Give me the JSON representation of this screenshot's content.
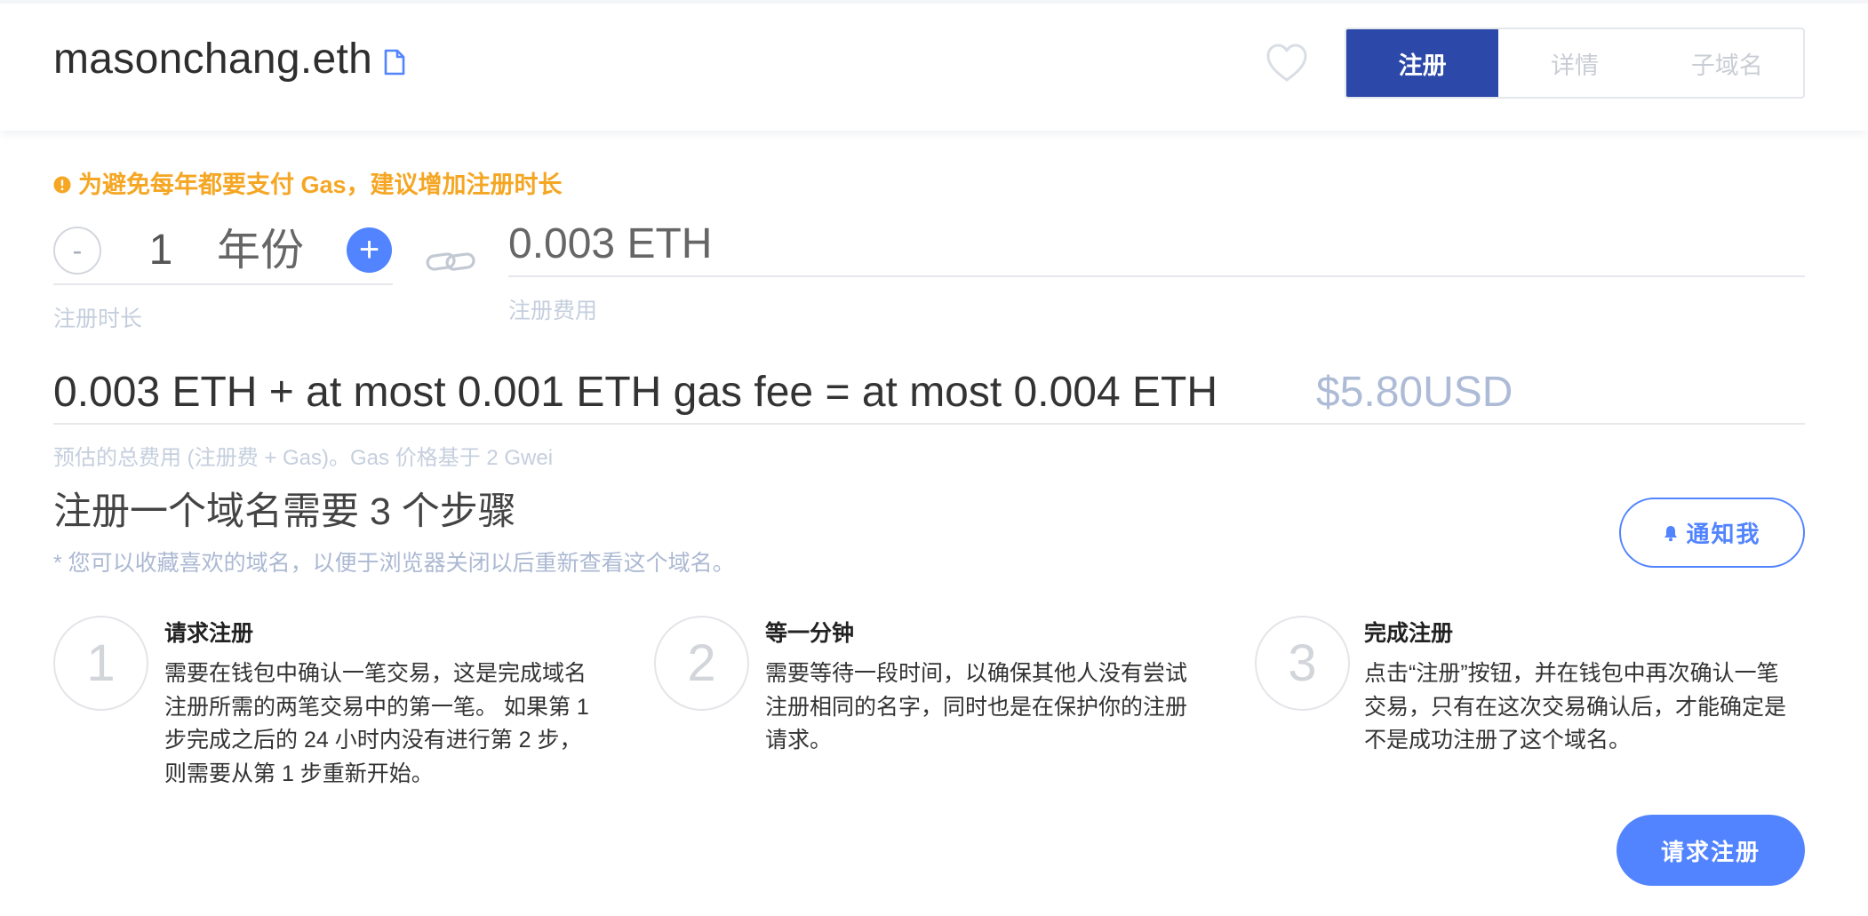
{
  "header": {
    "domain_name": "masonchang.eth",
    "tabs": [
      {
        "label": "注册",
        "active": true
      },
      {
        "label": "详情",
        "active": false
      },
      {
        "label": "子域名",
        "active": false
      }
    ]
  },
  "icons": {
    "domain_document": "file-icon",
    "favorite": "heart-icon",
    "warning": "alert-circle-icon",
    "link": "link-icon",
    "notify": "bell-icon"
  },
  "warning": {
    "text": "为避免每年都要支付 Gas，建议增加注册时长"
  },
  "duration": {
    "decrement_symbol": "-",
    "value": "1",
    "unit": "年份",
    "increment_symbol": "+",
    "label": "注册时长"
  },
  "price": {
    "value": "0.003 ETH",
    "label": "注册费用"
  },
  "total": {
    "summary": "0.003 ETH + at most 0.001 ETH gas fee = at most 0.004 ETH",
    "usd": "$5.80USD",
    "note": "预估的总费用 (注册费 + Gas)。Gas 价格基于 2 Gwei"
  },
  "steps_section": {
    "heading": "注册一个域名需要 3 个步骤",
    "note": "* 您可以收藏喜欢的域名，以便于浏览器关闭以后重新查看这个域名。",
    "notify_label": "通知我"
  },
  "steps": [
    {
      "number": "1",
      "title": "请求注册",
      "lines": [
        "需要在钱包中确认一笔交易，这是完成域名",
        "注册所需的两笔交易中的第一笔。 如果第 1",
        "步完成之后的 24 小时内没有进行第 2 步，",
        "则需要从第 1 步重新开始。"
      ]
    },
    {
      "number": "2",
      "title": "等一分钟",
      "lines": [
        "需要等待一段时间，以确保其他人没有尝试",
        "注册相同的名字，同时也是在保护你的注册",
        "请求。"
      ]
    },
    {
      "number": "3",
      "title": "完成注册",
      "lines": [
        "点击“注册”按钮，并在钱包中再次确认一笔",
        "交易，只有在这次交易确认后，才能确定是",
        "不是成功注册了这个域名。"
      ]
    }
  ],
  "action": {
    "request_label": "请求注册"
  },
  "colors": {
    "primary": "#5284ff",
    "tab_active": "#2c48a8",
    "warning": "#f5a623",
    "label": "#c5cfdd",
    "usd": "#adbbd6"
  }
}
